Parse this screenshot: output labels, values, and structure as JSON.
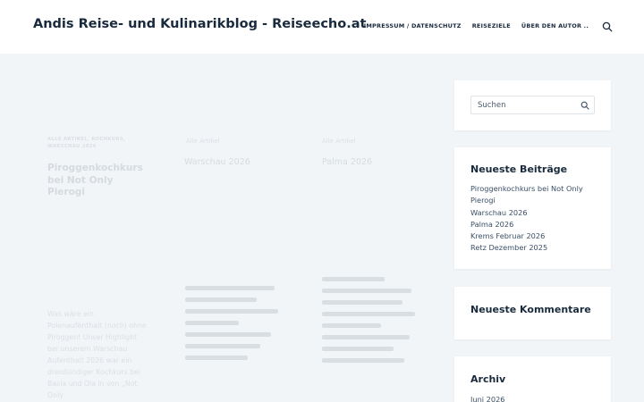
{
  "header": {
    "site_title": "Andis Reise- und Kulinarikblog - Reiseecho.at",
    "nav": [
      "IMPRESSUM / DATENSCHUTZ",
      "REISEZIELE",
      "ÜBER DEN AUTOR .."
    ]
  },
  "posts": [
    {
      "categories": "ALLE ARTIKEL, KOCHKURS, WARSCHAU 2026",
      "title": "Piroggenkochkurs bei Not Only Pierogi",
      "excerpt": "Was wäre ein Polenaufenthalt (noch) ohne Piroggen! Unser Highlight bei unserem Warschau Aufenthalt 2026 war ein dreistündiger Kochkurs bei Basia und Ola in von „Not Only"
    },
    {
      "categories": "Alle Artikel",
      "title": "Warschau 2026"
    },
    {
      "categories": "Alle Artikel",
      "title": "Palma 2026"
    }
  ],
  "sidebar": {
    "search": {
      "placeholder": "Suchen"
    },
    "recent_posts": {
      "title": "Neueste Beiträge",
      "items": [
        "Piroggenkochkurs bei Not Only Pierogi",
        "Warschau 2026",
        "Palma 2026",
        "Krems Februar 2026",
        "Retz Dezember 2025"
      ]
    },
    "recent_comments": {
      "title": "Neueste Kommentare"
    },
    "archive": {
      "title": "Archiv",
      "items": [
        "Juni 2026"
      ]
    }
  },
  "colors": {
    "heading": "#192a3d",
    "text": "#3a4f66",
    "page_bg": "#f2f5f7",
    "widget_bg": "#ffffff"
  },
  "icons": {
    "header_search": "search-icon",
    "widget_search": "search-icon"
  }
}
